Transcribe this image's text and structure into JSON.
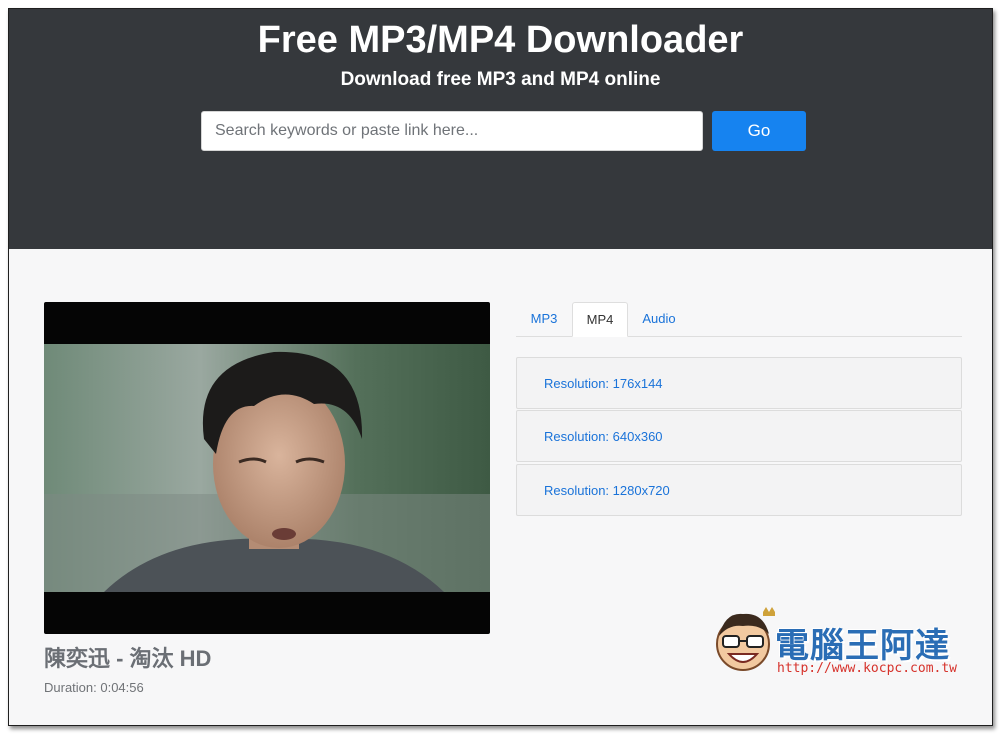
{
  "header": {
    "title": "Free MP3/MP4 Downloader",
    "subtitle": "Download free MP3 and MP4 online"
  },
  "search": {
    "placeholder": "Search keywords or paste link here...",
    "value": "",
    "button_label": "Go"
  },
  "video": {
    "title": "陳奕迅 - 淘汰 HD",
    "duration": "Duration: 0:04:56"
  },
  "tabs": [
    {
      "label": "MP3",
      "active": false
    },
    {
      "label": "MP4",
      "active": true
    },
    {
      "label": "Audio",
      "active": false
    }
  ],
  "resolutions": [
    {
      "label": "Resolution: 176x144"
    },
    {
      "label": "Resolution: 640x360"
    },
    {
      "label": "Resolution: 1280x720"
    }
  ],
  "watermark": {
    "name": "電腦王阿達",
    "url": "http://www.kocpc.com.tw"
  },
  "colors": {
    "header_bg": "#35383c",
    "accent": "#1683f0",
    "link": "#1a73d9",
    "watermark_blue": "#2a6db5",
    "watermark_red": "#d6322b"
  }
}
